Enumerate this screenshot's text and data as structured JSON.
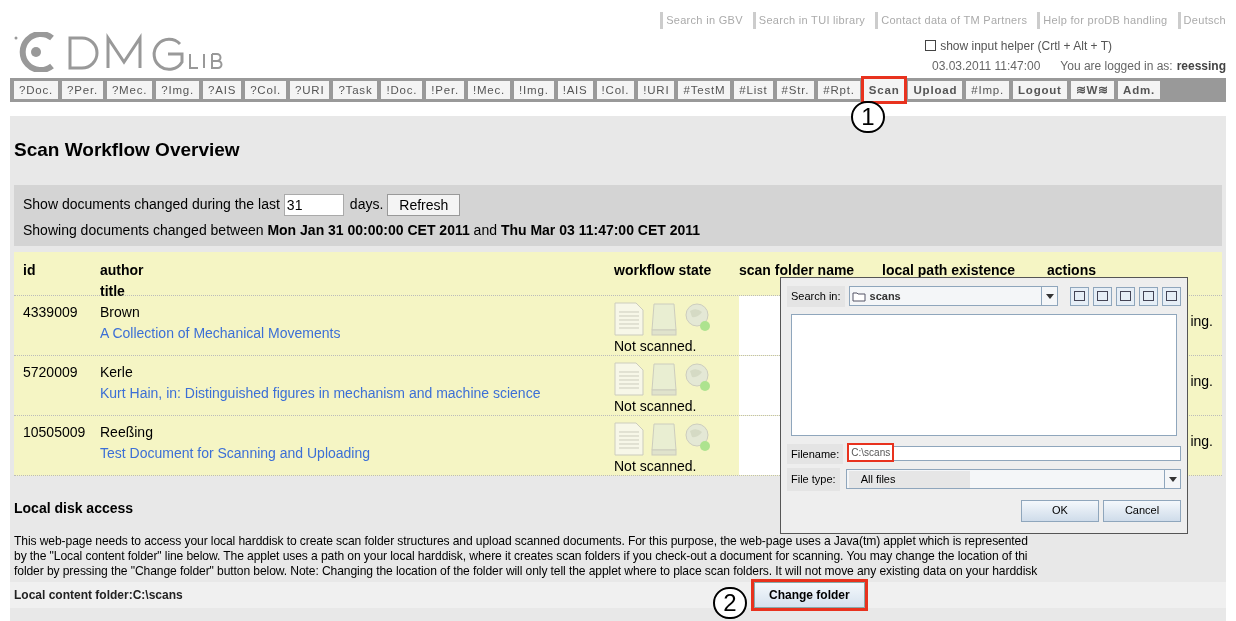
{
  "header": {
    "links": [
      "Search in GBV",
      "Search in TUI library",
      "Contact data of TM Partners",
      "Help for proDB handling",
      "Deutsch"
    ],
    "input_helper": {
      "label": "show input helper (Crtl + Alt + T)",
      "checked": false
    },
    "datetime": "03.03.2011 11:47:00",
    "login_label": "You are logged in as:",
    "username": "reessing"
  },
  "nav": [
    {
      "label": "?Doc.",
      "kind": "plain",
      "highlighted": false
    },
    {
      "label": "?Per.",
      "kind": "plain",
      "highlighted": false
    },
    {
      "label": "?Mec.",
      "kind": "plain",
      "highlighted": false
    },
    {
      "label": "?Img.",
      "kind": "plain",
      "highlighted": false
    },
    {
      "label": "?AIS",
      "kind": "plain",
      "highlighted": false
    },
    {
      "label": "?Col.",
      "kind": "plain",
      "highlighted": false
    },
    {
      "label": "?URI",
      "kind": "plain",
      "highlighted": false
    },
    {
      "label": "?Task",
      "kind": "plain",
      "highlighted": false
    },
    {
      "label": "!Doc.",
      "kind": "plain",
      "highlighted": false
    },
    {
      "label": "!Per.",
      "kind": "plain",
      "highlighted": false
    },
    {
      "label": "!Mec.",
      "kind": "plain",
      "highlighted": false
    },
    {
      "label": "!Img.",
      "kind": "plain",
      "highlighted": false
    },
    {
      "label": "!AIS",
      "kind": "plain",
      "highlighted": false
    },
    {
      "label": "!Col.",
      "kind": "plain",
      "highlighted": false
    },
    {
      "label": "!URI",
      "kind": "plain",
      "highlighted": false
    },
    {
      "label": "#TestM",
      "kind": "plain",
      "highlighted": false
    },
    {
      "label": "#List",
      "kind": "plain",
      "highlighted": false
    },
    {
      "label": "#Str.",
      "kind": "plain",
      "highlighted": false
    },
    {
      "label": "#Rpt.",
      "kind": "plain",
      "highlighted": false
    },
    {
      "label": "Scan",
      "kind": "bold",
      "highlighted": true
    },
    {
      "label": "Upload",
      "kind": "bold",
      "highlighted": false
    },
    {
      "label": "#Imp.",
      "kind": "plain",
      "highlighted": false
    },
    {
      "label": "Logout",
      "kind": "bold",
      "highlighted": false
    },
    {
      "label": "≋W≋",
      "kind": "bold",
      "highlighted": false
    },
    {
      "label": "Adm.",
      "kind": "bold",
      "highlighted": false
    }
  ],
  "callouts": [
    "1",
    "2"
  ],
  "page_title": "Scan Workflow Overview",
  "filter": {
    "label_before": "Show documents changed during the last",
    "days": "31",
    "label_after": "days.",
    "refresh_button": "Refresh",
    "range_text": "Showing documents changed between **Mon Jan 31 00:00:00 CET 2011** and **Thu Mar 03 11:47:00 CET 2011**"
  },
  "table": {
    "columns": [
      "id",
      "author",
      "workflow state",
      "scan folder name",
      "local path existence",
      "actions"
    ],
    "subheading": "title",
    "rows": [
      {
        "id": "4339009",
        "author": "Brown",
        "title": "A Collection of Mechanical Movements",
        "workflow_state": "Not scanned.",
        "actions": "ing."
      },
      {
        "id": "5720009",
        "author": "Kerle",
        "title": "Kurt Hain, in: Distinguished figures in mechanism and machine science",
        "workflow_state": "Not scanned.",
        "actions": "ing."
      },
      {
        "id": "10505009",
        "author": "Reeßing",
        "title": "Test Document for Scanning and Uploading",
        "workflow_state": "Not scanned.",
        "actions": "ing."
      }
    ]
  },
  "dialog": {
    "search_in_label": "Search in:",
    "folder": "scans",
    "filename_label": "Filename:",
    "filename": "C:\\scans",
    "file_type_label": "File type:",
    "file_type": "All files",
    "ok_button": "OK",
    "cancel_button": "Cancel"
  },
  "local_disk": {
    "heading": "Local disk access",
    "paragraph_lines": [
      "This web-page needs to access your local harddisk to create scan folder structures and upload scanned documents. For this purpose, the web-page uses a Java(tm) applet which is represented",
      "by the \"Local content folder\" line below. The applet uses a path on your local harddisk, where it creates scan folders if you check-out a document for scanning. You may change the location of thi",
      "folder by pressing the \"Change folder\" button below. Note: Changing the location of the folder will only tell the applet where to place scan folders. It will not move any existing data on your harddisk"
    ],
    "folder_label": "Local content folder:C:\\scans",
    "change_button": "Change folder"
  }
}
